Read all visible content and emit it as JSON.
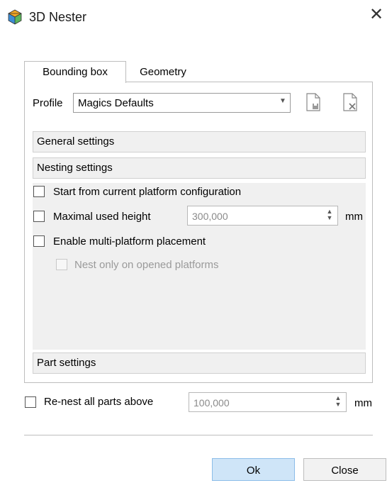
{
  "window": {
    "title": "3D Nester"
  },
  "tabs": [
    {
      "label": "Bounding box"
    },
    {
      "label": "Geometry"
    }
  ],
  "profile": {
    "label": "Profile",
    "value": "Magics Defaults"
  },
  "sections": {
    "general": "General settings",
    "nesting": "Nesting settings",
    "part": "Part settings"
  },
  "nesting": {
    "start_from_current": "Start from current platform configuration",
    "maximal_used_height": "Maximal used height",
    "maximal_used_height_value": "300,000",
    "unit": "mm",
    "enable_multi_platform": "Enable multi-platform placement",
    "nest_only_opened": "Nest only on opened platforms"
  },
  "renest": {
    "label": "Re-nest all parts above",
    "value": "100,000",
    "unit": "mm"
  },
  "buttons": {
    "ok": "Ok",
    "close": "Close"
  }
}
